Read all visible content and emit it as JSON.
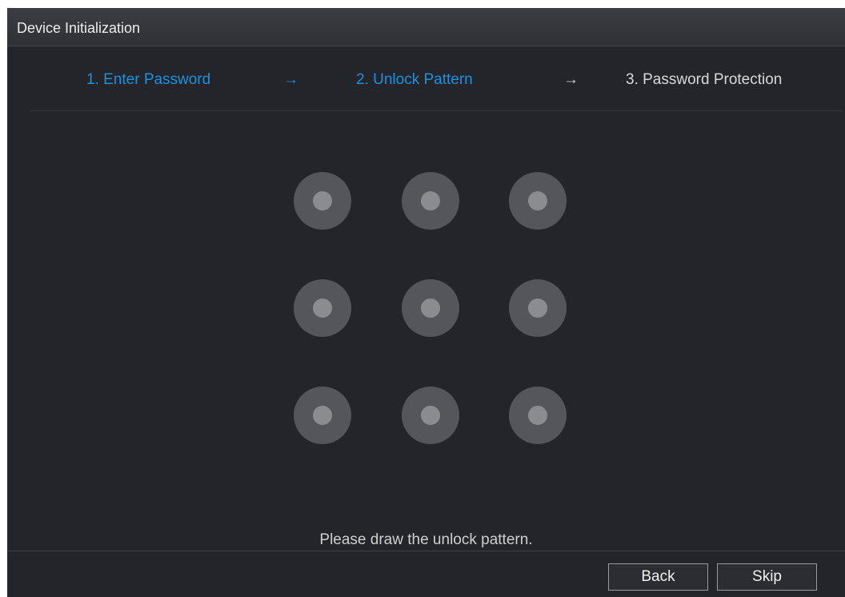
{
  "window": {
    "title": "Device Initialization"
  },
  "steps": [
    {
      "label": "1.  Enter Password",
      "state": "completed"
    },
    {
      "label": "2.  Unlock Pattern",
      "state": "current"
    },
    {
      "label": "3.  Password Protection",
      "state": "pending"
    }
  ],
  "step_arrows": [
    "→",
    "→"
  ],
  "pattern": {
    "grid": "3x3",
    "dots": [
      {
        "row": 1,
        "col": 1
      },
      {
        "row": 1,
        "col": 2
      },
      {
        "row": 1,
        "col": 3
      },
      {
        "row": 2,
        "col": 1
      },
      {
        "row": 2,
        "col": 2
      },
      {
        "row": 2,
        "col": 3
      },
      {
        "row": 3,
        "col": 1
      },
      {
        "row": 3,
        "col": 2
      },
      {
        "row": 3,
        "col": 3
      }
    ]
  },
  "hint": "Please draw the unlock pattern.",
  "footer": {
    "back_label": "Back",
    "skip_label": "Skip"
  },
  "colors": {
    "accent": "#1e90dc",
    "background": "#24252a",
    "dot_outer": "#55565b",
    "dot_inner": "#8b8c90"
  },
  "icons": {
    "step_arrow": "right-arrow-icon",
    "pattern_node": "pattern-dot-icon"
  }
}
